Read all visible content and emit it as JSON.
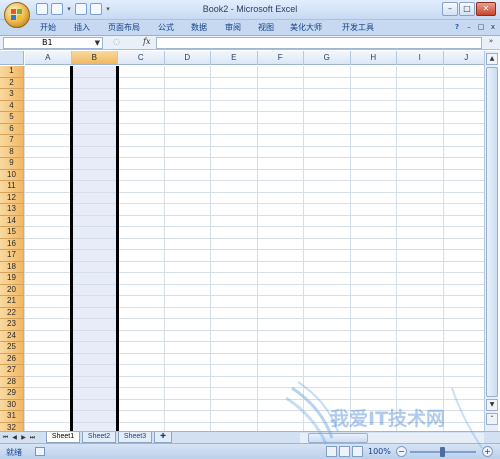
{
  "window": {
    "title": "Book2 - Microsoft Excel",
    "controls": {
      "minimize": "–",
      "maximize": "□",
      "close": "✕"
    }
  },
  "quick_access": [
    {
      "icon": "save-icon"
    },
    {
      "icon": "undo-icon"
    },
    {
      "icon": "redo-icon"
    },
    {
      "icon": "customize-icon"
    }
  ],
  "ribbon": {
    "tabs": [
      "开始",
      "插入",
      "页面布局",
      "公式",
      "数据",
      "审阅",
      "视图",
      "美化大师",
      "开发工具"
    ],
    "help": "?",
    "minimize": "–",
    "restore": "□",
    "close": "x"
  },
  "formula_bar": {
    "name_box": "B1",
    "fx": "fx",
    "formula": ""
  },
  "grid": {
    "columns": [
      "A",
      "B",
      "C",
      "D",
      "E",
      "F",
      "G",
      "H",
      "I",
      "J"
    ],
    "rows": [
      "1",
      "2",
      "3",
      "4",
      "5",
      "6",
      "7",
      "8",
      "9",
      "10",
      "11",
      "12",
      "13",
      "14",
      "15",
      "16",
      "17",
      "18",
      "19",
      "20",
      "21",
      "22",
      "23",
      "24",
      "25",
      "26",
      "27",
      "28",
      "29",
      "30",
      "31",
      "32"
    ],
    "selected_column": "B",
    "active_cell": "B1"
  },
  "sheets": {
    "tabs": [
      "Sheet1",
      "Sheet2",
      "Sheet3"
    ],
    "active": "Sheet1"
  },
  "status": {
    "ready": "就绪",
    "zoom": "100%"
  },
  "watermark": {
    "text": "我爱IT技术网"
  },
  "colors": {
    "row_header": "#f2b764",
    "selected_column_fill": "#e8ecf8",
    "ribbon_blue": "#c6d9f1"
  }
}
